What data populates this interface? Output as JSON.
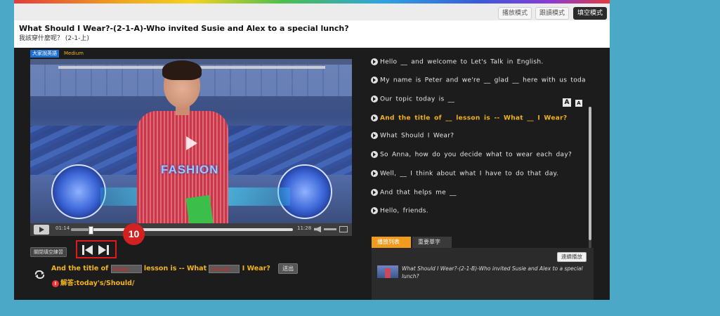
{
  "modes": {
    "playback": "播放模式",
    "follow": "跟讀模式",
    "cloze": "填空模式"
  },
  "header": {
    "title": "What Should I Wear?-(2-1-A)-Who invited Susie and Alex to a special lunch?",
    "subtitle": "我該穿什麼呢？ (2-1-上)"
  },
  "player": {
    "channel_badge": "大家說英語",
    "level": "Medium",
    "video_text": "FASHION",
    "time_current": "01:14",
    "time_total": "11:28",
    "progress": 0.09
  },
  "practice": {
    "dictation_button": "關閉填空練習",
    "step_badge": "10",
    "before": "And the title of",
    "blank1": "today",
    "middle": "lesson is -- What",
    "blank2": "should",
    "after": "I Wear?",
    "submit": "送出",
    "answer_icon": "!",
    "answer": "解答:today's/Should/"
  },
  "subtitles": {
    "font_big": "A",
    "font_small": "A",
    "lines": [
      {
        "text": "Hello __ and welcome to Let's Talk in English.",
        "active": false
      },
      {
        "text": "My name is Peter and we're __ glad __ here with us today.",
        "active": false
      },
      {
        "text": "Our topic today is __",
        "active": false
      },
      {
        "text": "And the title of __ lesson is -- What __ I Wear?",
        "active": true
      },
      {
        "text": "What Should I Wear?",
        "active": false
      },
      {
        "text": "So Anna, how do you decide what to wear each day?",
        "active": false
      },
      {
        "text": "Well, __ I think about what I have to do that day.",
        "active": false
      },
      {
        "text": "And that helps me __",
        "active": false
      },
      {
        "text": "Hello, friends.",
        "active": false
      }
    ]
  },
  "tabs": {
    "playlist": "播放列表",
    "vocab": "重要單字"
  },
  "playlist": {
    "continuous": "連續播放",
    "item_title": "What Should I Wear?-(2-1-B)-Who invited Susie and Alex to a special lunch?"
  }
}
